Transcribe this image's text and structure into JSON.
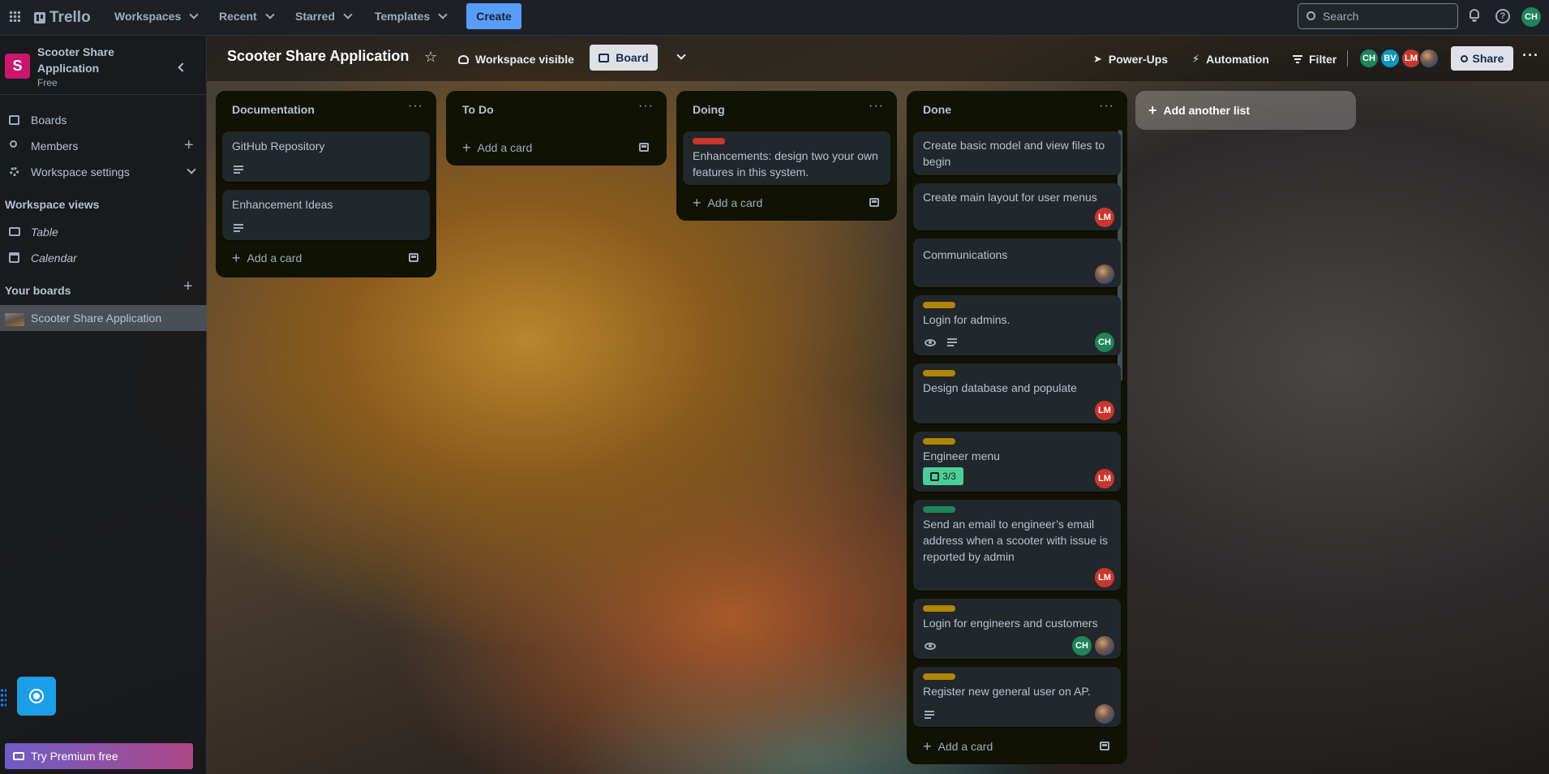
{
  "topbar": {
    "app_name": "Trello",
    "workspaces": "Workspaces",
    "recent": "Recent",
    "starred": "Starred",
    "templates": "Templates",
    "create": "Create",
    "search_placeholder": "Search",
    "user_initials": "CH"
  },
  "sidebar": {
    "workspace_initial": "S",
    "workspace_name": "Scooter Share Application",
    "plan": "Free",
    "items": [
      {
        "label": "Boards"
      },
      {
        "label": "Members"
      },
      {
        "label": "Workspace settings"
      }
    ],
    "views_heading": "Workspace views",
    "views": [
      {
        "label": "Table"
      },
      {
        "label": "Calendar"
      }
    ],
    "boards_heading": "Your boards",
    "boards": [
      {
        "label": "Scooter Share Application"
      }
    ],
    "premium": "Try Premium free"
  },
  "board": {
    "title": "Scooter Share Application",
    "visibility": "Workspace visible",
    "view": "Board",
    "power_ups": "Power-Ups",
    "automation": "Automation",
    "filter": "Filter",
    "share": "Share",
    "members": [
      "CH",
      "BV",
      "LM"
    ]
  },
  "lists": [
    {
      "title": "Documentation",
      "add_card": "Add a card",
      "cards": [
        {
          "text": "GitHub Repository"
        },
        {
          "text": "Enhancement Ideas"
        }
      ]
    },
    {
      "title": "To Do",
      "add_card": "Add a card",
      "cards": []
    },
    {
      "title": "Doing",
      "add_card": "Add a card",
      "cards": [
        {
          "text": "Enhancements: design two your own features in this system.",
          "label_color": "#c9372c"
        }
      ]
    },
    {
      "title": "Done",
      "add_card": "Add a card",
      "cards": [
        {
          "text": "Create basic model and view files to begin"
        },
        {
          "text": "Create main layout for user menus",
          "members": [
            "LM"
          ]
        },
        {
          "text": "Communications"
        },
        {
          "text": "Login for admins.",
          "label_color": "#b38600",
          "members": [
            "CH"
          ]
        },
        {
          "text": "Design database and populate",
          "label_color": "#b38600",
          "members": [
            "LM"
          ]
        },
        {
          "text": "Engineer menu",
          "label_color": "#b38600",
          "checklist": "3/3",
          "members": [
            "LM"
          ]
        },
        {
          "text": "Send an email to engineer’s email address when a scooter with issue is reported by admin",
          "label_color": "#1f845a",
          "members": [
            "LM"
          ]
        },
        {
          "text": "Login for engineers and customers",
          "label_color": "#b38600",
          "members": [
            "CH"
          ]
        },
        {
          "text": "Register new general user on AP.",
          "label_color": "#b38600"
        }
      ]
    }
  ],
  "add_list": "Add another list",
  "colors": {
    "accent": "#579dff",
    "list_bg": "#101204",
    "card_bg": "#22272b"
  }
}
